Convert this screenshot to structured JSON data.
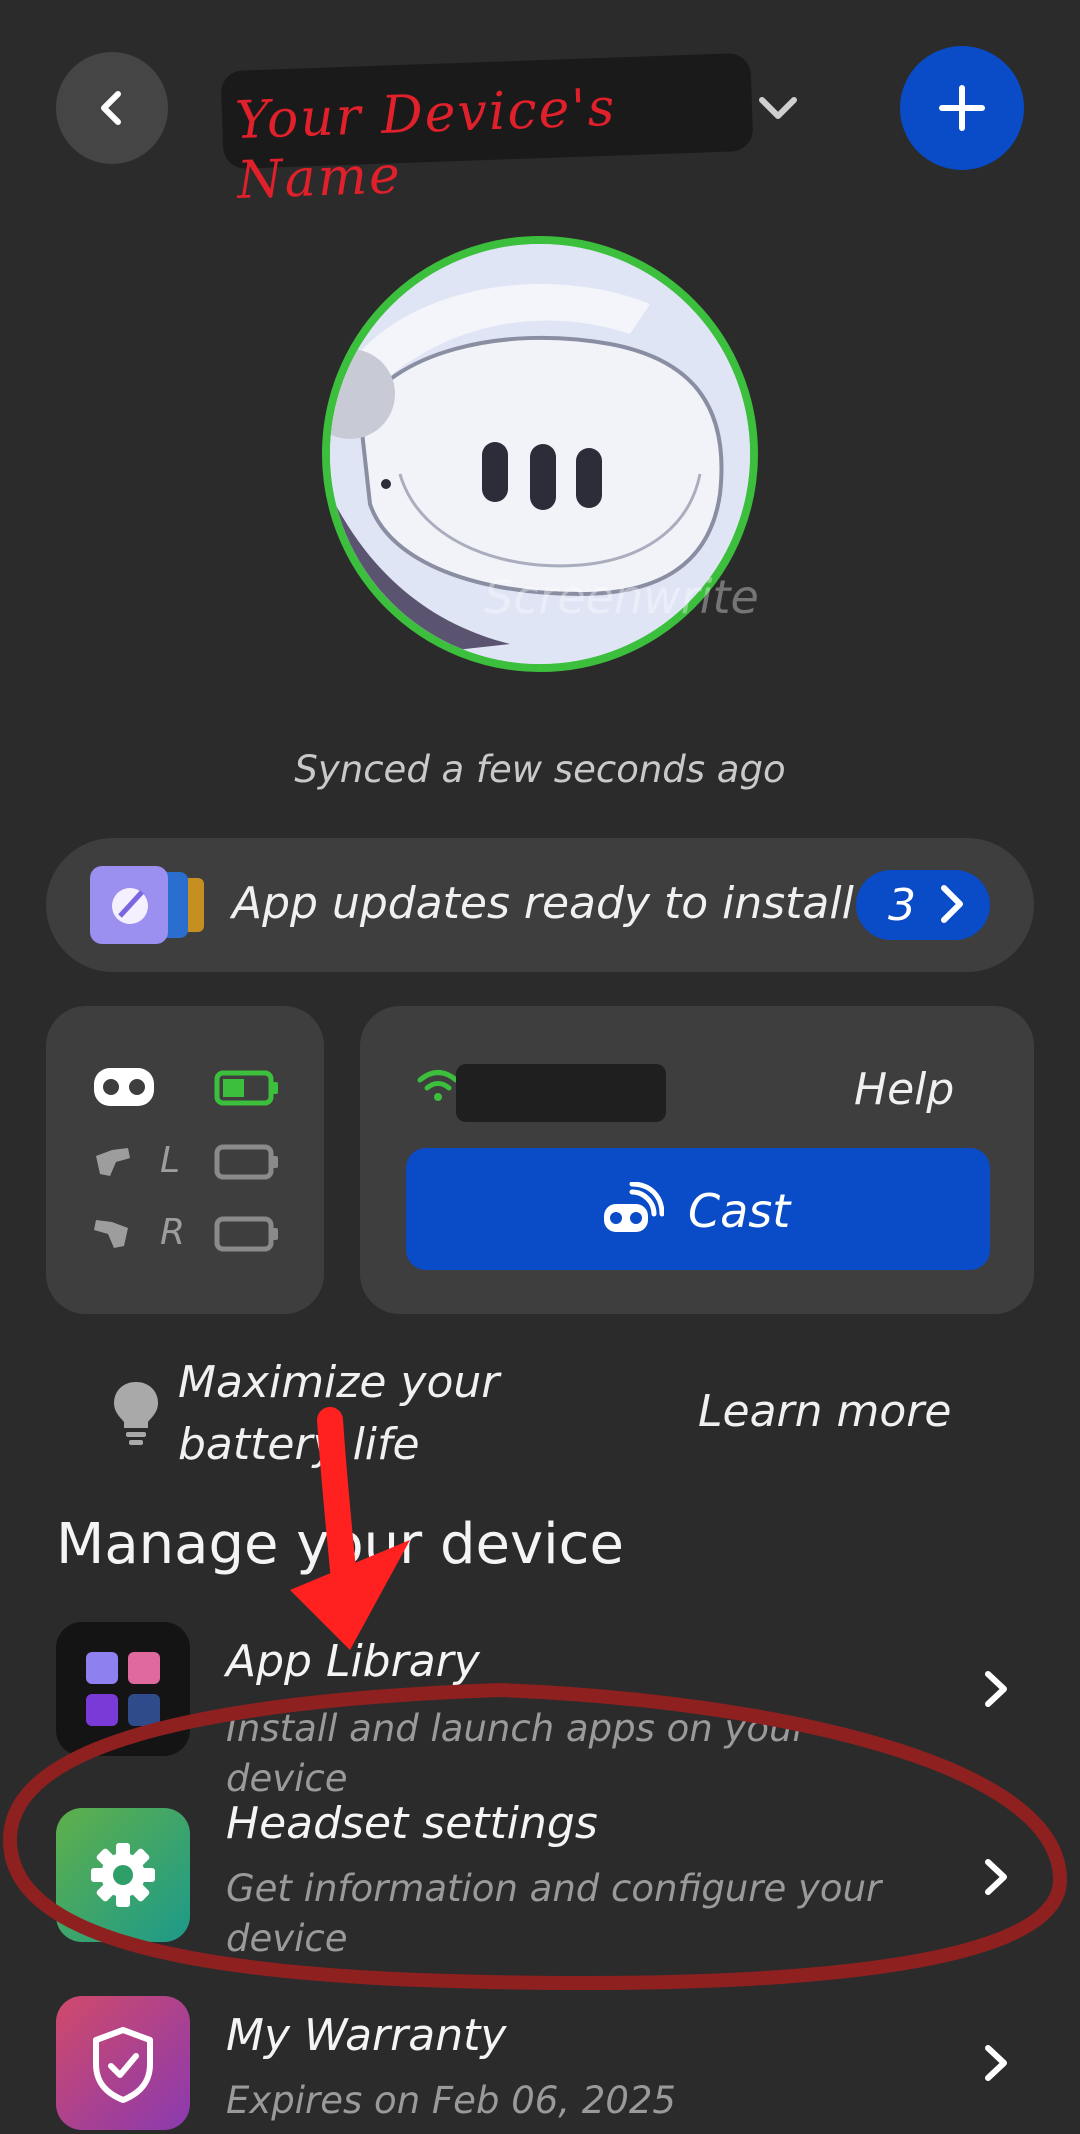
{
  "header": {
    "device_name": "Your Device's Name",
    "back_icon": "chevron-left-icon",
    "dropdown_icon": "chevron-down-icon",
    "add_icon": "plus-icon"
  },
  "device": {
    "watermark": "Screenwrite",
    "sync_status": "Synced a few seconds ago"
  },
  "updates": {
    "label": "App updates ready to install",
    "count": "3"
  },
  "battery": {
    "headset_level": 0.5,
    "left_label": "L",
    "right_label": "R"
  },
  "network": {
    "help_label": "Help",
    "cast_label": "Cast"
  },
  "tip": {
    "text": "Maximize your battery life",
    "learn_more": "Learn more"
  },
  "manage": {
    "title": "Manage your device",
    "items": [
      {
        "title": "App Library",
        "subtitle": "Install and launch apps on your device"
      },
      {
        "title": "Headset settings",
        "subtitle": "Get information and configure your device"
      },
      {
        "title": "My Warranty",
        "subtitle": "Expires on Feb 06, 2025"
      }
    ]
  },
  "colors": {
    "background": "#2b2b2b",
    "card": "#3e3e3e",
    "accent_blue": "#0a4bc8",
    "status_green": "#3cbf3c",
    "annotation_red": "#e0202a"
  }
}
